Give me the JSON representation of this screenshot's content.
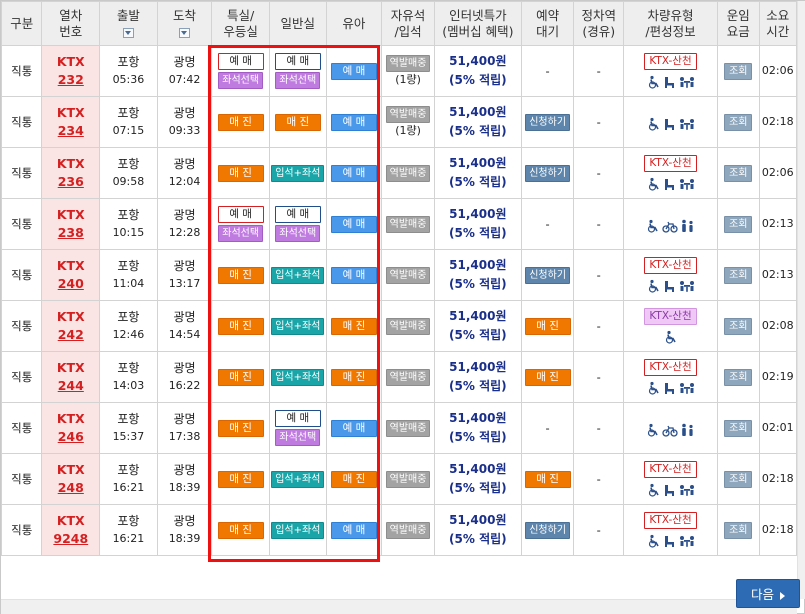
{
  "header": {
    "type": "구분",
    "train_l1": "열차",
    "train_l2": "번호",
    "depart": "출발",
    "arrive": "도착",
    "special_l1": "특실/",
    "special_l2": "우등실",
    "general": "일반실",
    "infant": "유아",
    "free_l1": "자유석",
    "free_l2": "/입석",
    "internet_l1": "인터넷특가",
    "internet_l2": "(멤버십 혜택)",
    "reserve_l1": "예약",
    "reserve_l2": "대기",
    "stop_l1": "정차역",
    "stop_l2": "(경유)",
    "vehicle_l1": "차량유형",
    "vehicle_l2": "/편성정보",
    "fare_l1": "운임",
    "fare_l2": "요금",
    "dur_l1": "소요",
    "dur_l2": "시간"
  },
  "rows": [
    {
      "type": "직통",
      "train": "KTX",
      "num": "232",
      "from": "포항",
      "dep": "05:36",
      "to": "광명",
      "arr": "07:42",
      "special": {
        "kind": "yemae",
        "text": "예 매",
        "sub": "좌석선택"
      },
      "general": {
        "kind": "yemae-b",
        "text": "예 매",
        "sub": "좌석선택"
      },
      "infant": {
        "kind": "blue",
        "text": "예 매"
      },
      "free": "역발매중",
      "free_sub": "(1량)",
      "price": "51,400원",
      "points": "(5% 적립)",
      "reserve": {
        "kind": "dash",
        "text": "-"
      },
      "stop": "-",
      "vehicle": {
        "ktx": "KTX-산천",
        "ktx_style": "red",
        "icons": [
          "wheelchair",
          "seat",
          "table"
        ]
      },
      "fare": "조회",
      "dur": "02:06"
    },
    {
      "type": "직통",
      "train": "KTX",
      "num": "234",
      "from": "포항",
      "dep": "07:15",
      "to": "광명",
      "arr": "09:33",
      "special": {
        "kind": "orange",
        "text": "매 진"
      },
      "general": {
        "kind": "orange",
        "text": "매 진"
      },
      "infant": {
        "kind": "blue",
        "text": "예 매"
      },
      "free": "역발매중",
      "free_sub": "(1량)",
      "price": "51,400원",
      "points": "(5% 적립)",
      "reserve": {
        "kind": "steel",
        "text": "신청하기"
      },
      "stop": "-",
      "vehicle": {
        "ktx": "",
        "ktx_style": "",
        "icons": [
          "wheelchair",
          "seat",
          "table"
        ]
      },
      "fare": "조회",
      "dur": "02:18"
    },
    {
      "type": "직통",
      "train": "KTX",
      "num": "236",
      "from": "포항",
      "dep": "09:58",
      "to": "광명",
      "arr": "12:04",
      "special": {
        "kind": "orange",
        "text": "매 진"
      },
      "general": {
        "kind": "teal",
        "text": "입석+좌석"
      },
      "infant": {
        "kind": "blue",
        "text": "예 매"
      },
      "free": "역발매중",
      "free_sub": "",
      "price": "51,400원",
      "points": "(5% 적립)",
      "reserve": {
        "kind": "steel",
        "text": "신청하기"
      },
      "stop": "-",
      "vehicle": {
        "ktx": "KTX-산천",
        "ktx_style": "red",
        "icons": [
          "wheelchair",
          "seat",
          "table"
        ]
      },
      "fare": "조회",
      "dur": "02:06"
    },
    {
      "type": "직통",
      "train": "KTX",
      "num": "238",
      "from": "포항",
      "dep": "10:15",
      "to": "광명",
      "arr": "12:28",
      "special": {
        "kind": "yemae",
        "text": "예 매",
        "sub": "좌석선택"
      },
      "general": {
        "kind": "yemae-b",
        "text": "예 매",
        "sub": "좌석선택"
      },
      "infant": {
        "kind": "blue",
        "text": "예 매"
      },
      "free": "역발매중",
      "free_sub": "",
      "price": "51,400원",
      "points": "(5% 적립)",
      "reserve": {
        "kind": "dash",
        "text": "-"
      },
      "stop": "-",
      "vehicle": {
        "ktx": "",
        "ktx_style": "",
        "icons": [
          "wheelchair",
          "bike",
          "family"
        ]
      },
      "fare": "조회",
      "dur": "02:13"
    },
    {
      "type": "직통",
      "train": "KTX",
      "num": "240",
      "from": "포항",
      "dep": "11:04",
      "to": "광명",
      "arr": "13:17",
      "special": {
        "kind": "orange",
        "text": "매 진"
      },
      "general": {
        "kind": "teal",
        "text": "입석+좌석"
      },
      "infant": {
        "kind": "blue",
        "text": "예 매"
      },
      "free": "역발매중",
      "free_sub": "",
      "price": "51,400원",
      "points": "(5% 적립)",
      "reserve": {
        "kind": "steel",
        "text": "신청하기"
      },
      "stop": "-",
      "vehicle": {
        "ktx": "KTX-산천",
        "ktx_style": "red",
        "icons": [
          "wheelchair",
          "seat",
          "table"
        ]
      },
      "fare": "조회",
      "dur": "02:13"
    },
    {
      "type": "직통",
      "train": "KTX",
      "num": "242",
      "from": "포항",
      "dep": "12:46",
      "to": "광명",
      "arr": "14:54",
      "special": {
        "kind": "orange",
        "text": "매 진"
      },
      "general": {
        "kind": "teal",
        "text": "입석+좌석"
      },
      "infant": {
        "kind": "orange",
        "text": "매 진"
      },
      "free": "역발매중",
      "free_sub": "",
      "price": "51,400원",
      "points": "(5% 적립)",
      "reserve": {
        "kind": "orange",
        "text": "매 진"
      },
      "stop": "-",
      "vehicle": {
        "ktx": "KTX-산천",
        "ktx_style": "purple",
        "icons": [
          "wheelchair"
        ]
      },
      "fare": "조회",
      "dur": "02:08"
    },
    {
      "type": "직통",
      "train": "KTX",
      "num": "244",
      "from": "포항",
      "dep": "14:03",
      "to": "광명",
      "arr": "16:22",
      "special": {
        "kind": "orange",
        "text": "매 진"
      },
      "general": {
        "kind": "teal",
        "text": "입석+좌석"
      },
      "infant": {
        "kind": "orange",
        "text": "매 진"
      },
      "free": "역발매중",
      "free_sub": "",
      "price": "51,400원",
      "points": "(5% 적립)",
      "reserve": {
        "kind": "orange",
        "text": "매 진"
      },
      "stop": "-",
      "vehicle": {
        "ktx": "KTX-산천",
        "ktx_style": "red",
        "icons": [
          "wheelchair",
          "seat",
          "table"
        ]
      },
      "fare": "조회",
      "dur": "02:19"
    },
    {
      "type": "직통",
      "train": "KTX",
      "num": "246",
      "from": "포항",
      "dep": "15:37",
      "to": "광명",
      "arr": "17:38",
      "special": {
        "kind": "orange",
        "text": "매 진"
      },
      "general": {
        "kind": "yemae-b",
        "text": "예 매",
        "sub": "좌석선택"
      },
      "infant": {
        "kind": "blue",
        "text": "예 매"
      },
      "free": "역발매중",
      "free_sub": "",
      "price": "51,400원",
      "points": "(5% 적립)",
      "reserve": {
        "kind": "dash",
        "text": "-"
      },
      "stop": "-",
      "vehicle": {
        "ktx": "",
        "ktx_style": "",
        "icons": [
          "wheelchair",
          "bike",
          "family"
        ]
      },
      "fare": "조회",
      "dur": "02:01"
    },
    {
      "type": "직통",
      "train": "KTX",
      "num": "248",
      "from": "포항",
      "dep": "16:21",
      "to": "광명",
      "arr": "18:39",
      "special": {
        "kind": "orange",
        "text": "매 진"
      },
      "general": {
        "kind": "teal",
        "text": "입석+좌석"
      },
      "infant": {
        "kind": "orange",
        "text": "매 진"
      },
      "free": "역발매중",
      "free_sub": "",
      "price": "51,400원",
      "points": "(5% 적립)",
      "reserve": {
        "kind": "orange",
        "text": "매 진"
      },
      "stop": "-",
      "vehicle": {
        "ktx": "KTX-산천",
        "ktx_style": "red",
        "icons": [
          "wheelchair",
          "seat",
          "table"
        ]
      },
      "fare": "조회",
      "dur": "02:18"
    },
    {
      "type": "직통",
      "train": "KTX",
      "num": "9248",
      "from": "포항",
      "dep": "16:21",
      "to": "광명",
      "arr": "18:39",
      "special": {
        "kind": "orange",
        "text": "매 진"
      },
      "general": {
        "kind": "teal",
        "text": "입석+좌석"
      },
      "infant": {
        "kind": "blue",
        "text": "예 매"
      },
      "free": "역발매중",
      "free_sub": "",
      "price": "51,400원",
      "points": "(5% 적립)",
      "reserve": {
        "kind": "steel",
        "text": "신청하기"
      },
      "stop": "-",
      "vehicle": {
        "ktx": "KTX-산천",
        "ktx_style": "red",
        "icons": [
          "wheelchair",
          "seat",
          "table"
        ]
      },
      "fare": "조회",
      "dur": "02:18"
    }
  ],
  "footer": {
    "next_label": "다음"
  },
  "colors": {
    "highlight_box": "#ee1111",
    "sold_out": "#f07800",
    "reserve": "#4a98ea",
    "train_number": "#d42020",
    "price": "#1a2f8a"
  }
}
